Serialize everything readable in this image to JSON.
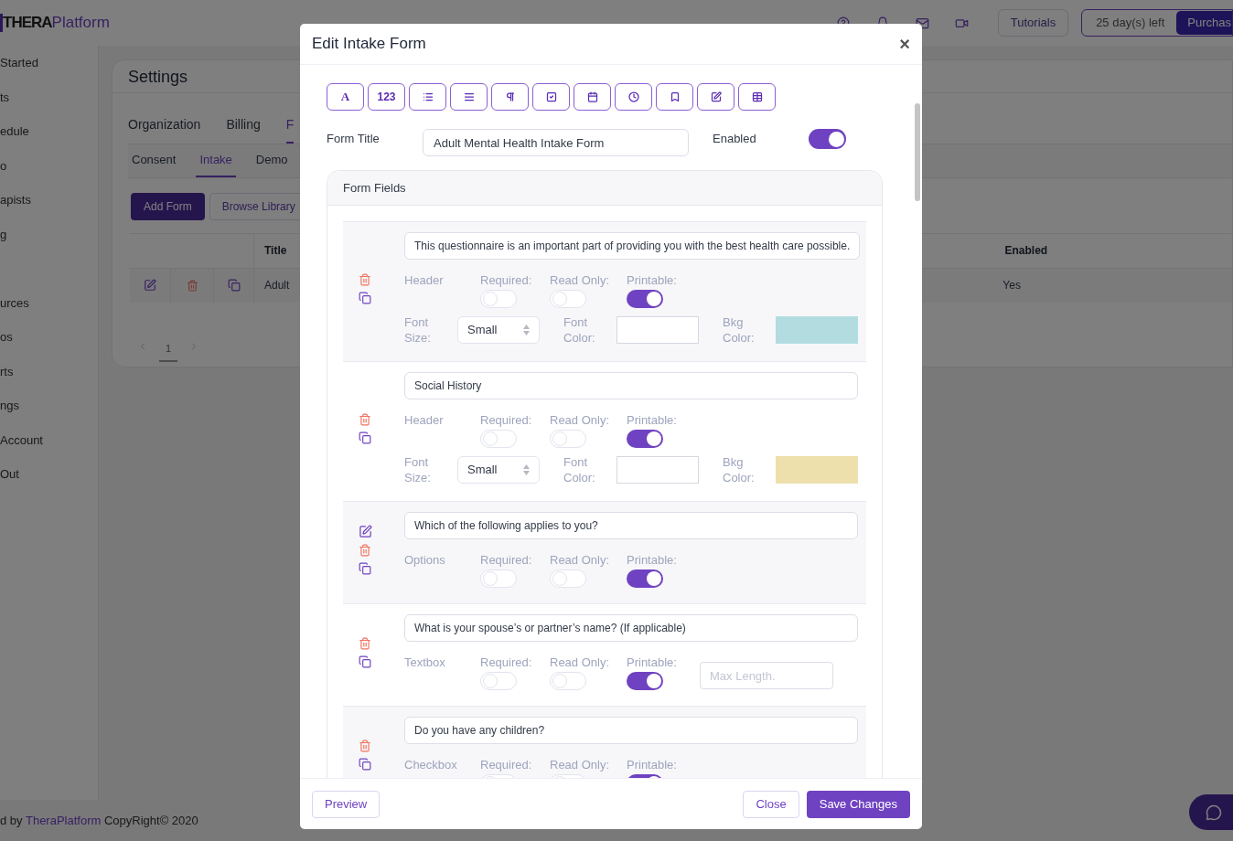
{
  "topbar": {
    "logo_bold": "THERA",
    "logo_light": "Platform",
    "tutorials": "Tutorials",
    "trial": "25 day(s) left",
    "purchase": "Purchas"
  },
  "sidebar": {
    "items": [
      "Started",
      "ts",
      "edule",
      "o",
      "apists",
      "g",
      "urces",
      "os",
      "rts",
      "ngs",
      "Account",
      "Out"
    ]
  },
  "settings": {
    "title": "Settings",
    "tabs": [
      {
        "label": "Organization",
        "selected": false
      },
      {
        "label": "Billing",
        "selected": false
      },
      {
        "label": "F",
        "selected": true
      }
    ],
    "subtabs": [
      {
        "label": "Consent",
        "selected": false
      },
      {
        "label": "Intake",
        "selected": true
      },
      {
        "label": "Demo",
        "selected": false
      }
    ],
    "add_button": "Add Form",
    "library_button": "Browse Library",
    "table": {
      "columns": [
        "Title",
        "Enabled"
      ],
      "rows": [
        {
          "title": "Adult",
          "enabled": "Yes"
        }
      ]
    },
    "page": "1"
  },
  "footer": {
    "prefix": "d by",
    "link": "TheraPlatform",
    "suffix": "CopyRight© 2020"
  },
  "modal": {
    "title": "Edit Intake Form",
    "close": "×",
    "toolbar_text_buttons": [
      "A",
      "123"
    ],
    "form_title_label": "Form Title",
    "form_title": "Adult Mental Health Intake Form",
    "enabled_label": "Enabled",
    "enabled": true,
    "fields_title": "Form Fields",
    "fields": [
      {
        "kind": "header",
        "editable": false,
        "question": "This questionnaire is an important part of providing you with the best health care possible.",
        "type": "Header",
        "toggles": [
          {
            "label": "Required:",
            "on": false
          },
          {
            "label": "Read Only:",
            "on": false
          },
          {
            "label": "Printable:",
            "on": true
          }
        ],
        "font_size_label": "Font Size:",
        "font_size": "Small",
        "font_color_label": "Font Color:",
        "bkg_color_label": "Bkg Color:",
        "color": "#b2dce0"
      },
      {
        "kind": "header",
        "editable": false,
        "question": "Social History",
        "type": "Header",
        "toggles": [
          {
            "label": "Required:",
            "on": false
          },
          {
            "label": "Read Only:",
            "on": false
          },
          {
            "label": "Printable:",
            "on": true
          }
        ],
        "font_size_label": "Font Size:",
        "font_size": "Small",
        "font_color_label": "Font Color:",
        "bkg_color_label": "Bkg Color:",
        "color": "#ede0ad"
      },
      {
        "kind": "options",
        "editable": true,
        "question": "Which of the following applies to you?",
        "type": "Options",
        "toggles": [
          {
            "label": "Required:",
            "on": false
          },
          {
            "label": "Read Only:",
            "on": false
          },
          {
            "label": "Printable:",
            "on": true
          }
        ]
      },
      {
        "kind": "textbox",
        "editable": false,
        "question": "What is your spouse’s or partner’s name? (If applicable)",
        "type": "Textbox",
        "toggles": [
          {
            "label": "Required:",
            "on": false
          },
          {
            "label": "Read Only:",
            "on": false
          },
          {
            "label": "Printable:",
            "on": true
          }
        ],
        "max_length_placeholder": "Max Length."
      },
      {
        "kind": "checkbox",
        "editable": false,
        "question": "Do you have any children?",
        "type": "Checkbox",
        "toggles": [
          {
            "label": "Required:",
            "on": false
          },
          {
            "label": "Read Only:",
            "on": false
          },
          {
            "label": "Printable:",
            "on": true
          }
        ]
      }
    ],
    "preview": "Preview",
    "close_button": "Close",
    "save": "Save Changes"
  }
}
